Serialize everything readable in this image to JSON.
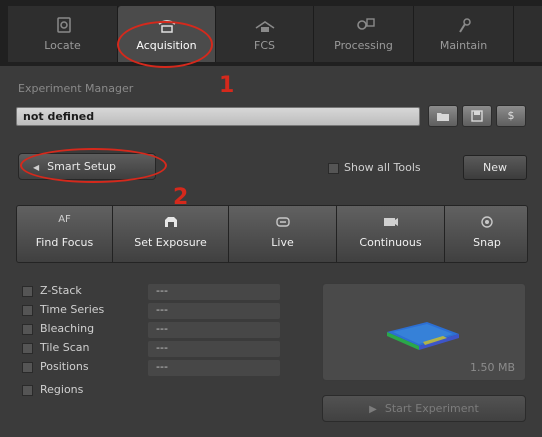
{
  "tabs": [
    {
      "label": "Locate",
      "icon": "locate-icon",
      "active": false
    },
    {
      "label": "Acquisition",
      "icon": "acquisition-icon",
      "active": true
    },
    {
      "label": "FCS",
      "icon": "fcs-icon",
      "active": false
    },
    {
      "label": "Processing",
      "icon": "processing-icon",
      "active": false
    },
    {
      "label": "Maintain",
      "icon": "maintain-icon",
      "active": false
    }
  ],
  "experiment_manager": {
    "section_label": "Experiment Manager",
    "value": "not defined",
    "buttons": [
      {
        "icon": "open-folder-icon"
      },
      {
        "icon": "save-icon"
      },
      {
        "icon": "dollar-icon",
        "label": "$"
      }
    ]
  },
  "smart_setup": {
    "label": "Smart Setup"
  },
  "show_all_tools": {
    "label": "Show all Tools",
    "checked": false
  },
  "new_button": {
    "label": "New"
  },
  "actions": [
    {
      "label": "Find Focus",
      "top_label": "AF",
      "icon": "af-icon"
    },
    {
      "label": "Set Exposure",
      "icon": "exposure-icon"
    },
    {
      "label": "Live",
      "icon": "live-icon"
    },
    {
      "label": "Continuous",
      "icon": "continuous-icon"
    },
    {
      "label": "Snap",
      "icon": "snap-icon"
    }
  ],
  "dimensions": [
    {
      "label": "Z-Stack",
      "value": "---",
      "checked": false
    },
    {
      "label": "Time Series",
      "value": "---",
      "checked": false
    },
    {
      "label": "Bleaching",
      "value": "---",
      "checked": false
    },
    {
      "label": "Tile Scan",
      "value": "---",
      "checked": false
    },
    {
      "label": "Positions",
      "value": "---",
      "checked": false
    },
    {
      "label": "Regions",
      "checked": false
    }
  ],
  "preview": {
    "size": "1.50 MB"
  },
  "start_experiment": {
    "label": "Start Experiment"
  },
  "annotations": [
    {
      "label": "1"
    },
    {
      "label": "2"
    }
  ],
  "colors": {
    "annotation": "#d5291c",
    "background": "#3b3b3b",
    "active_tab": "#4b4b4b"
  }
}
